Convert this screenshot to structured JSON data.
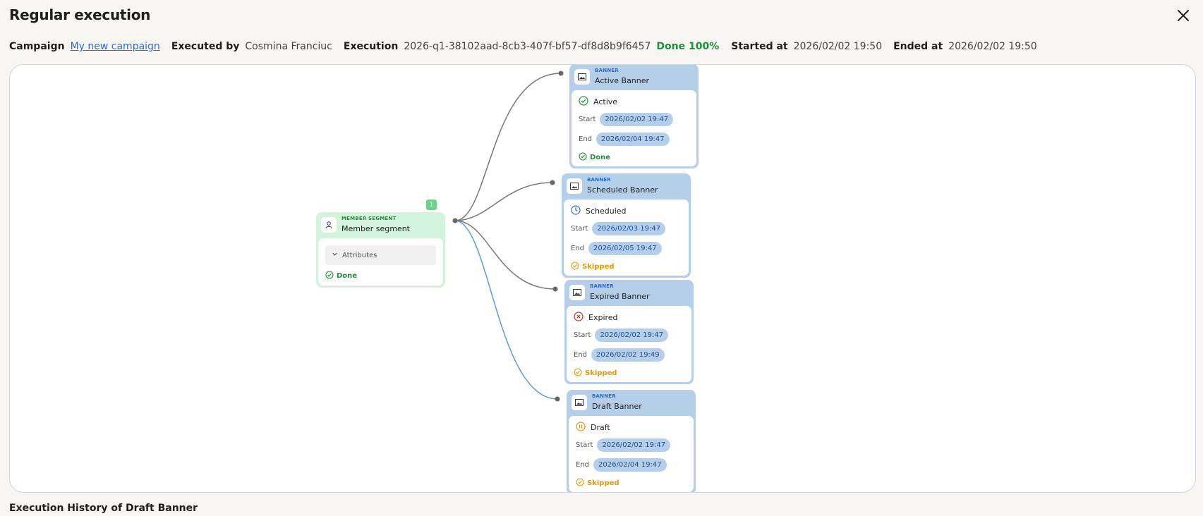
{
  "dialog": {
    "title": "Regular execution"
  },
  "meta": {
    "campaign_label": "Campaign",
    "campaign_name": "My new campaign",
    "executed_by_label": "Executed by",
    "executed_by": "Cosmina Franciuc",
    "execution_label": "Execution",
    "execution_id": "2026-q1-38102aad-8cb3-407f-bf57-df8d8b9f6457",
    "execution_status": "Done 100%",
    "started_label": "Started at",
    "started_at": "2026/02/02 19:50",
    "ended_label": "Ended at",
    "ended_at": "2026/02/02 19:50"
  },
  "segment": {
    "kind": "MEMBER SEGMENT",
    "name": "Member segment",
    "badge": "1",
    "attributes_label": "Attributes",
    "result": "Done"
  },
  "banners": [
    {
      "kind": "BANNER",
      "name": "Active Banner",
      "status": "Active",
      "start_label": "Start",
      "start": "2026/02/02 19:47",
      "end_label": "End",
      "end": "2026/02/04 19:47",
      "result": "Done"
    },
    {
      "kind": "BANNER",
      "name": "Scheduled Banner",
      "status": "Scheduled",
      "start_label": "Start",
      "start": "2026/02/03 19:47",
      "end_label": "End",
      "end": "2026/02/05 19:47",
      "result": "Skipped"
    },
    {
      "kind": "BANNER",
      "name": "Expired Banner",
      "status": "Expired",
      "start_label": "Start",
      "start": "2026/02/02 19:47",
      "end_label": "End",
      "end": "2026/02/02 19:49",
      "result": "Skipped"
    },
    {
      "kind": "BANNER",
      "name": "Draft Banner",
      "status": "Draft",
      "start_label": "Start",
      "start": "2026/02/02 19:47",
      "end_label": "End",
      "end": "2026/02/04 19:47",
      "result": "Skipped"
    }
  ],
  "history": {
    "title": "Execution History of Draft Banner"
  },
  "colors": {
    "done_green": "#1f8f3a",
    "skipped_orange": "#e39a06",
    "link_blue": "#2a6ad8",
    "banner_blue": "#b5cfea",
    "segment_green": "#d4f3dc"
  }
}
